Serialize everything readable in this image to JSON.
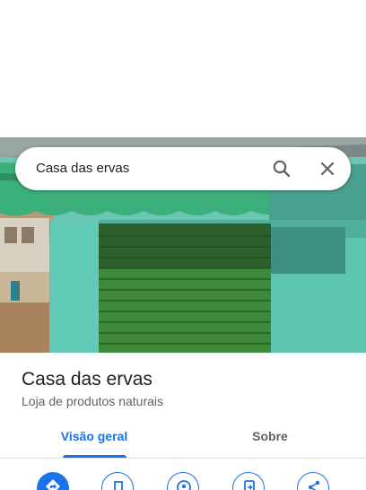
{
  "search": {
    "value": "Casa das ervas"
  },
  "place": {
    "name": "Casa das ervas",
    "category": "Loja de produtos naturais"
  },
  "tabs": [
    {
      "label": "Visão geral",
      "active": true
    },
    {
      "label": "Sobre",
      "active": false
    }
  ],
  "actions": [
    {
      "icon": "directions-icon"
    },
    {
      "icon": "save-icon"
    },
    {
      "icon": "nearby-icon"
    },
    {
      "icon": "send-to-phone-icon"
    },
    {
      "icon": "share-icon"
    }
  ],
  "colors": {
    "accent": "#1a73e8",
    "title": "#202124",
    "secondary": "#5f6368"
  }
}
